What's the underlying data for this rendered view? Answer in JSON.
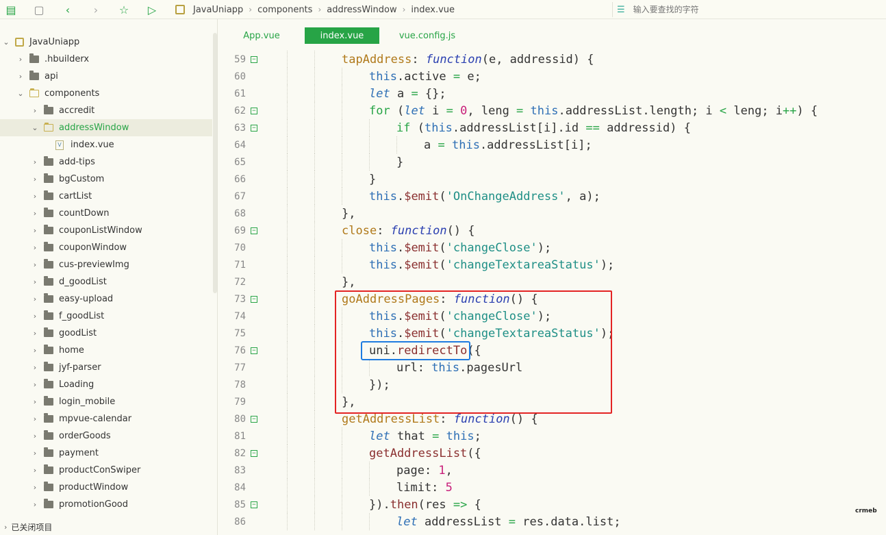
{
  "toolbar": {
    "icons": [
      "new-file-icon",
      "save-icon",
      "back-icon",
      "forward-icon",
      "star-icon",
      "run-icon"
    ],
    "breadcrumb": [
      "JavaUniapp",
      "components",
      "addressWindow",
      "index.vue"
    ],
    "search_placeholder": "输入要查找的字符"
  },
  "sidebar": {
    "items": [
      {
        "label": "JavaUniapp",
        "level": 0,
        "type": "project",
        "expanded": true
      },
      {
        "label": ".hbuilderx",
        "level": 1,
        "type": "folder",
        "expanded": false
      },
      {
        "label": "api",
        "level": 1,
        "type": "folder",
        "expanded": false
      },
      {
        "label": "components",
        "level": 1,
        "type": "folder",
        "expanded": true
      },
      {
        "label": "accredit",
        "level": 2,
        "type": "folder",
        "expanded": false
      },
      {
        "label": "addressWindow",
        "level": 2,
        "type": "folder",
        "expanded": true,
        "selected": true
      },
      {
        "label": "index.vue",
        "level": 3,
        "type": "file"
      },
      {
        "label": "add-tips",
        "level": 2,
        "type": "folder",
        "expanded": false
      },
      {
        "label": "bgCustom",
        "level": 2,
        "type": "folder",
        "expanded": false
      },
      {
        "label": "cartList",
        "level": 2,
        "type": "folder",
        "expanded": false
      },
      {
        "label": "countDown",
        "level": 2,
        "type": "folder",
        "expanded": false
      },
      {
        "label": "couponListWindow",
        "level": 2,
        "type": "folder",
        "expanded": false
      },
      {
        "label": "couponWindow",
        "level": 2,
        "type": "folder",
        "expanded": false
      },
      {
        "label": "cus-previewImg",
        "level": 2,
        "type": "folder",
        "expanded": false
      },
      {
        "label": "d_goodList",
        "level": 2,
        "type": "folder",
        "expanded": false
      },
      {
        "label": "easy-upload",
        "level": 2,
        "type": "folder",
        "expanded": false
      },
      {
        "label": "f_goodList",
        "level": 2,
        "type": "folder",
        "expanded": false
      },
      {
        "label": "goodList",
        "level": 2,
        "type": "folder",
        "expanded": false
      },
      {
        "label": "home",
        "level": 2,
        "type": "folder",
        "expanded": false
      },
      {
        "label": "jyf-parser",
        "level": 2,
        "type": "folder",
        "expanded": false
      },
      {
        "label": "Loading",
        "level": 2,
        "type": "folder",
        "expanded": false
      },
      {
        "label": "login_mobile",
        "level": 2,
        "type": "folder",
        "expanded": false
      },
      {
        "label": "mpvue-calendar",
        "level": 2,
        "type": "folder",
        "expanded": false
      },
      {
        "label": "orderGoods",
        "level": 2,
        "type": "folder",
        "expanded": false
      },
      {
        "label": "payment",
        "level": 2,
        "type": "folder",
        "expanded": false
      },
      {
        "label": "productConSwiper",
        "level": 2,
        "type": "folder",
        "expanded": false
      },
      {
        "label": "productWindow",
        "level": 2,
        "type": "folder",
        "expanded": false
      },
      {
        "label": "promotionGood",
        "level": 2,
        "type": "folder",
        "expanded": false
      }
    ],
    "footer": "已关闭项目"
  },
  "tabs": [
    {
      "label": "App.vue",
      "active": false
    },
    {
      "label": "index.vue",
      "active": true
    },
    {
      "label": "vue.config.js",
      "active": false
    }
  ],
  "editor": {
    "lines": [
      {
        "n": "59",
        "fold": true,
        "indent": 1,
        "tokens": [
          [
            "prop",
            "tapAddress"
          ],
          [
            "p",
            ": "
          ],
          [
            "f",
            "function"
          ],
          [
            "p",
            "(e, addressid) {"
          ]
        ]
      },
      {
        "n": "60",
        "fold": false,
        "indent": 2,
        "tokens": [
          [
            "t",
            "this"
          ],
          [
            "p",
            ".active "
          ],
          [
            "k",
            "="
          ],
          [
            "p",
            " e;"
          ]
        ]
      },
      {
        "n": "61",
        "fold": false,
        "indent": 2,
        "tokens": [
          [
            "lt",
            "let"
          ],
          [
            "p",
            " a "
          ],
          [
            "k",
            "="
          ],
          [
            "p",
            " {};"
          ]
        ]
      },
      {
        "n": "62",
        "fold": true,
        "indent": 2,
        "tokens": [
          [
            "k",
            "for"
          ],
          [
            "p",
            " ("
          ],
          [
            "lt",
            "let"
          ],
          [
            "p",
            " i "
          ],
          [
            "k",
            "="
          ],
          [
            "p",
            " "
          ],
          [
            "n",
            "0"
          ],
          [
            "p",
            ", leng "
          ],
          [
            "k",
            "="
          ],
          [
            "p",
            " "
          ],
          [
            "t",
            "this"
          ],
          [
            "p",
            ".addressList.length; i "
          ],
          [
            "k",
            "<"
          ],
          [
            "p",
            " leng; i"
          ],
          [
            "k",
            "++"
          ],
          [
            "p",
            ") {"
          ]
        ]
      },
      {
        "n": "63",
        "fold": true,
        "indent": 3,
        "tokens": [
          [
            "k",
            "if"
          ],
          [
            "p",
            " ("
          ],
          [
            "t",
            "this"
          ],
          [
            "p",
            ".addressList[i].id "
          ],
          [
            "k",
            "=="
          ],
          [
            "p",
            " addressid) {"
          ]
        ]
      },
      {
        "n": "64",
        "fold": false,
        "indent": 4,
        "tokens": [
          [
            "p",
            "a "
          ],
          [
            "k",
            "="
          ],
          [
            "p",
            " "
          ],
          [
            "t",
            "this"
          ],
          [
            "p",
            ".addressList[i];"
          ]
        ]
      },
      {
        "n": "65",
        "fold": false,
        "indent": 3,
        "tokens": [
          [
            "p",
            "}"
          ]
        ]
      },
      {
        "n": "66",
        "fold": false,
        "indent": 2,
        "tokens": [
          [
            "p",
            "}"
          ]
        ]
      },
      {
        "n": "67",
        "fold": false,
        "indent": 2,
        "tokens": [
          [
            "t",
            "this"
          ],
          [
            "p",
            "."
          ],
          [
            "m",
            "$emit"
          ],
          [
            "p",
            "("
          ],
          [
            "s",
            "'OnChangeAddress'"
          ],
          [
            "p",
            ", a);"
          ]
        ]
      },
      {
        "n": "68",
        "fold": false,
        "indent": 1,
        "tokens": [
          [
            "p",
            "},"
          ]
        ]
      },
      {
        "n": "69",
        "fold": true,
        "indent": 1,
        "tokens": [
          [
            "prop",
            "close"
          ],
          [
            "p",
            ": "
          ],
          [
            "f",
            "function"
          ],
          [
            "p",
            "() {"
          ]
        ]
      },
      {
        "n": "70",
        "fold": false,
        "indent": 2,
        "tokens": [
          [
            "t",
            "this"
          ],
          [
            "p",
            "."
          ],
          [
            "m",
            "$emit"
          ],
          [
            "p",
            "("
          ],
          [
            "s",
            "'changeClose'"
          ],
          [
            "p",
            ");"
          ]
        ]
      },
      {
        "n": "71",
        "fold": false,
        "indent": 2,
        "tokens": [
          [
            "t",
            "this"
          ],
          [
            "p",
            "."
          ],
          [
            "m",
            "$emit"
          ],
          [
            "p",
            "("
          ],
          [
            "s",
            "'changeTextareaStatus'"
          ],
          [
            "p",
            ");"
          ]
        ]
      },
      {
        "n": "72",
        "fold": false,
        "indent": 1,
        "tokens": [
          [
            "p",
            "},"
          ]
        ]
      },
      {
        "n": "73",
        "fold": true,
        "indent": 1,
        "tokens": [
          [
            "prop",
            "goAddressPages"
          ],
          [
            "p",
            ": "
          ],
          [
            "f",
            "function"
          ],
          [
            "p",
            "() {"
          ]
        ]
      },
      {
        "n": "74",
        "fold": false,
        "indent": 2,
        "tokens": [
          [
            "t",
            "this"
          ],
          [
            "p",
            "."
          ],
          [
            "m",
            "$emit"
          ],
          [
            "p",
            "("
          ],
          [
            "s",
            "'changeClose'"
          ],
          [
            "p",
            ");"
          ]
        ]
      },
      {
        "n": "75",
        "fold": false,
        "indent": 2,
        "tokens": [
          [
            "t",
            "this"
          ],
          [
            "p",
            "."
          ],
          [
            "m",
            "$emit"
          ],
          [
            "p",
            "("
          ],
          [
            "s",
            "'changeTextareaStatus'"
          ],
          [
            "p",
            ");"
          ]
        ]
      },
      {
        "n": "76",
        "fold": true,
        "indent": 2,
        "tokens": [
          [
            "p",
            "uni."
          ],
          [
            "m",
            "redirectTo"
          ],
          [
            "p",
            "({"
          ]
        ]
      },
      {
        "n": "77",
        "fold": false,
        "indent": 3,
        "tokens": [
          [
            "p",
            "url: "
          ],
          [
            "t",
            "this"
          ],
          [
            "p",
            ".pagesUrl"
          ]
        ]
      },
      {
        "n": "78",
        "fold": false,
        "indent": 2,
        "tokens": [
          [
            "p",
            "});"
          ]
        ]
      },
      {
        "n": "79",
        "fold": false,
        "indent": 1,
        "tokens": [
          [
            "p",
            "},"
          ]
        ]
      },
      {
        "n": "80",
        "fold": true,
        "indent": 1,
        "tokens": [
          [
            "prop",
            "getAddressList"
          ],
          [
            "p",
            ": "
          ],
          [
            "f",
            "function"
          ],
          [
            "p",
            "() {"
          ]
        ]
      },
      {
        "n": "81",
        "fold": false,
        "indent": 2,
        "tokens": [
          [
            "lt",
            "let"
          ],
          [
            "p",
            " that "
          ],
          [
            "k",
            "="
          ],
          [
            "p",
            " "
          ],
          [
            "t",
            "this"
          ],
          [
            "p",
            ";"
          ]
        ]
      },
      {
        "n": "82",
        "fold": true,
        "indent": 2,
        "tokens": [
          [
            "m",
            "getAddressList"
          ],
          [
            "p",
            "({"
          ]
        ]
      },
      {
        "n": "83",
        "fold": false,
        "indent": 3,
        "tokens": [
          [
            "p",
            "page: "
          ],
          [
            "n",
            "1"
          ],
          [
            "p",
            ","
          ]
        ]
      },
      {
        "n": "84",
        "fold": false,
        "indent": 3,
        "tokens": [
          [
            "p",
            "limit: "
          ],
          [
            "n",
            "5"
          ]
        ]
      },
      {
        "n": "85",
        "fold": true,
        "indent": 2,
        "tokens": [
          [
            "p",
            "})."
          ],
          [
            "m",
            "then"
          ],
          [
            "p",
            "(res "
          ],
          [
            "k",
            "=>"
          ],
          [
            "p",
            " {"
          ]
        ]
      },
      {
        "n": "86",
        "fold": false,
        "indent": 3,
        "tokens": [
          [
            "lt",
            "let"
          ],
          [
            "p",
            " addressList "
          ],
          [
            "k",
            "="
          ],
          [
            "p",
            " res.data.list;"
          ]
        ]
      }
    ]
  },
  "watermark": "crmeb"
}
